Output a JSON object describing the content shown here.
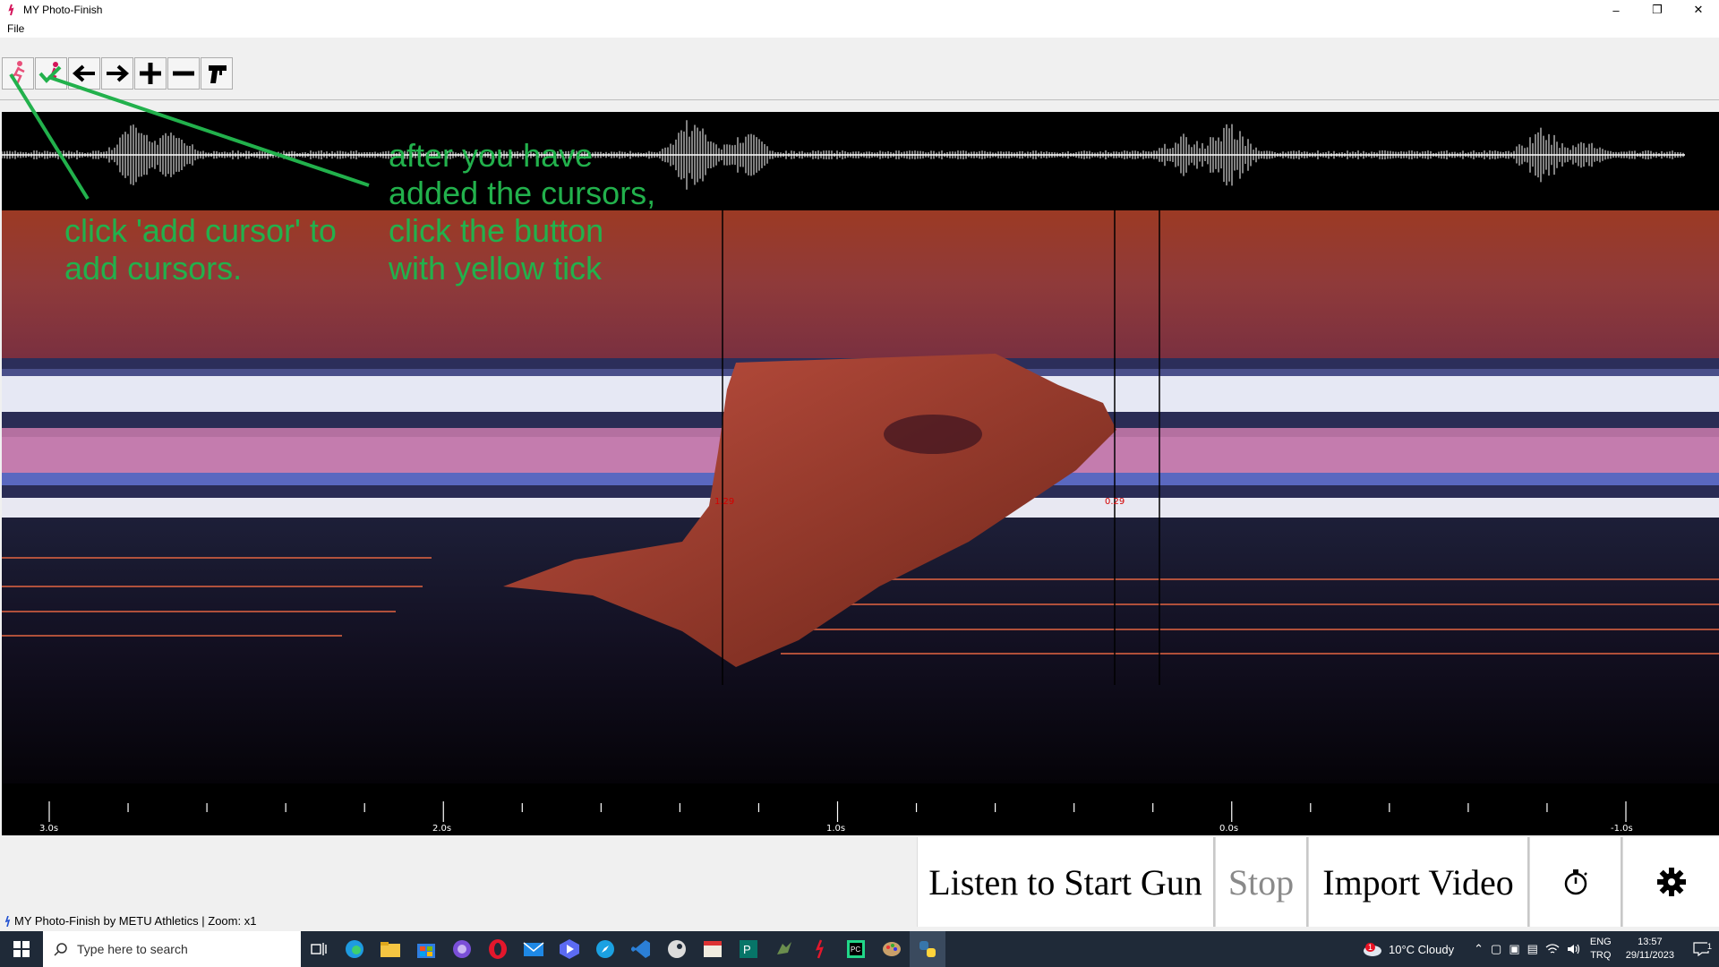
{
  "window": {
    "title": "MY Photo-Finish",
    "minimize_glyph": "–",
    "maximize_glyph": "❐",
    "close_glyph": "✕"
  },
  "menu": {
    "file_label": "File"
  },
  "toolbar": {
    "buttons": [
      "add-cursor",
      "confirm-cursors",
      "scroll-left",
      "scroll-right",
      "zoom-in",
      "zoom-out",
      "start-gun"
    ]
  },
  "annotations": {
    "left_line1": "click 'add cursor' to",
    "left_line2": "add cursors.",
    "right_line1": "after you have",
    "right_line2": "added the cursors,",
    "right_line3": "click the button",
    "right_line4": "with yellow tick"
  },
  "timeline": {
    "labels": [
      "3.0s",
      "2.0s",
      "1.0s",
      "0.0s",
      "-1.0s"
    ]
  },
  "cursors": {
    "label1": "1.29",
    "label2": "0.29"
  },
  "bottom_buttons": {
    "listen": "Listen to Start Gun",
    "stop": "Stop",
    "import": "Import Video"
  },
  "status": {
    "text": "MY Photo-Finish by METU Athletics | Zoom: x1"
  },
  "taskbar": {
    "search_placeholder": "Type here to search",
    "weather": "10°C  Cloudy",
    "weather_badge": "1",
    "lang_top": "ENG",
    "lang_bottom": "TRQ",
    "time": "13:57",
    "date": "29/11/2023",
    "notification_count": "1"
  },
  "colors": {
    "annotation": "#22b14c",
    "taskbar": "#1f2a38",
    "cursor_label": "#d40000"
  }
}
